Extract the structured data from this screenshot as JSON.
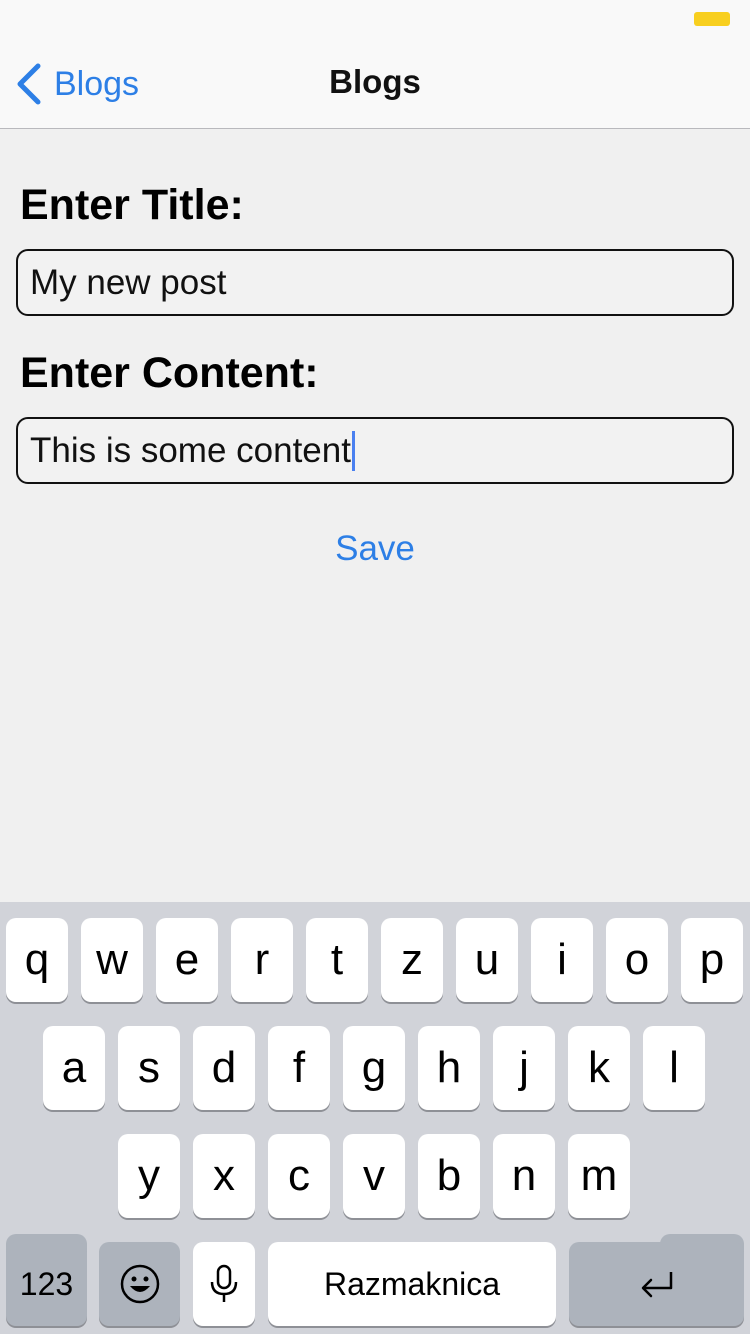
{
  "nav": {
    "back_label": "Blogs",
    "title": "Blogs"
  },
  "form": {
    "title_label": "Enter Title:",
    "title_value": "My new post",
    "content_label": "Enter Content:",
    "content_value": "This is some content",
    "save_label": "Save"
  },
  "keyboard": {
    "row1": [
      "q",
      "w",
      "e",
      "r",
      "t",
      "z",
      "u",
      "i",
      "o",
      "p"
    ],
    "row2": [
      "a",
      "s",
      "d",
      "f",
      "g",
      "h",
      "j",
      "k",
      "l"
    ],
    "row3": [
      "y",
      "x",
      "c",
      "v",
      "b",
      "n",
      "m"
    ],
    "numbers_label": "123",
    "space_label": "Razmaknica"
  },
  "colors": {
    "accent": "#2d7fe6",
    "battery": "#f8cf1f",
    "keyboard_bg": "#d1d3d9"
  }
}
